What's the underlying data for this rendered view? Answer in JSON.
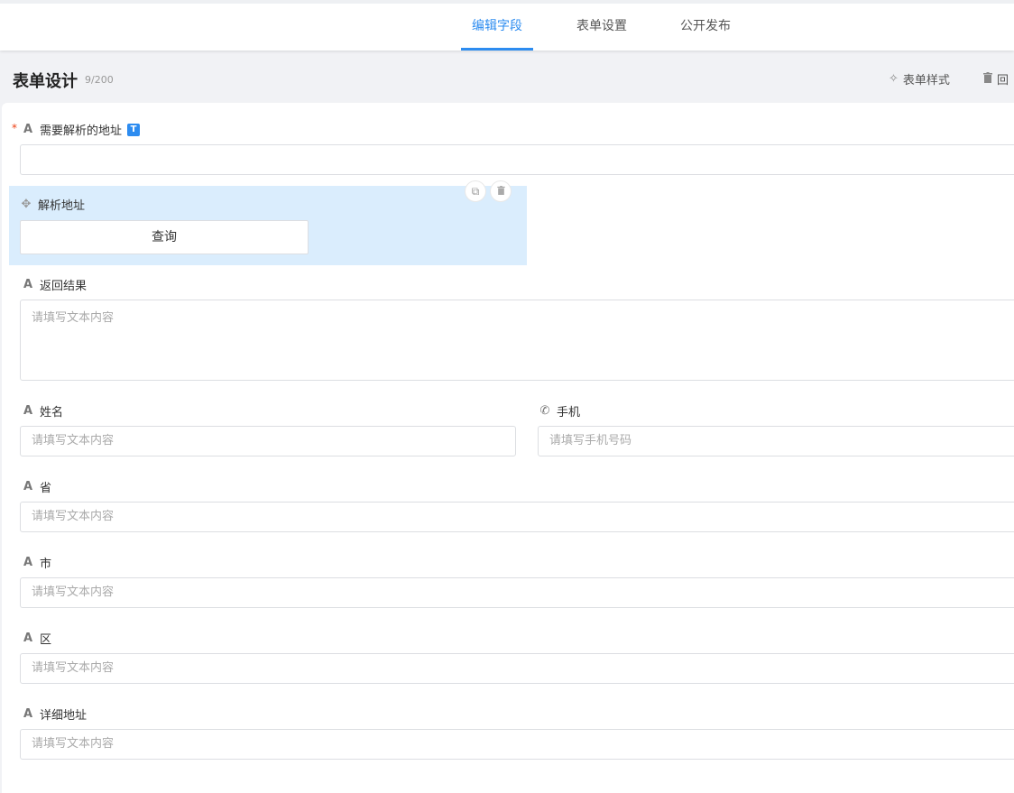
{
  "tabs": [
    {
      "label": "编辑字段",
      "active": true
    },
    {
      "label": "表单设置",
      "active": false
    },
    {
      "label": "公开发布",
      "active": false
    }
  ],
  "header": {
    "title": "表单设计",
    "count": "9/200",
    "style_button": "表单样式",
    "delete_button": "回"
  },
  "fields": {
    "address_input": {
      "label": "需要解析的地址",
      "badge": "T",
      "value": ""
    },
    "parse": {
      "label": "解析地址",
      "button": "查询"
    },
    "result": {
      "label": "返回结果",
      "placeholder": "请填写文本内容"
    },
    "name": {
      "label": "姓名",
      "placeholder": "请填写文本内容"
    },
    "phone": {
      "label": "手机",
      "placeholder": "请填写手机号码"
    },
    "province": {
      "label": "省",
      "placeholder": "请填写文本内容"
    },
    "city": {
      "label": "市",
      "placeholder": "请填写文本内容"
    },
    "district": {
      "label": "区",
      "placeholder": "请填写文本内容"
    },
    "detail": {
      "label": "详细地址",
      "placeholder": "请填写文本内容"
    }
  },
  "colors": {
    "accent": "#2d8cf0",
    "selected_bg": "#daedfd",
    "required": "#ed4014"
  },
  "icons": {
    "text_field": "A",
    "phone": "✆",
    "move": "✥",
    "copy": "⧉",
    "trash": "🗑",
    "magic": "✧"
  }
}
